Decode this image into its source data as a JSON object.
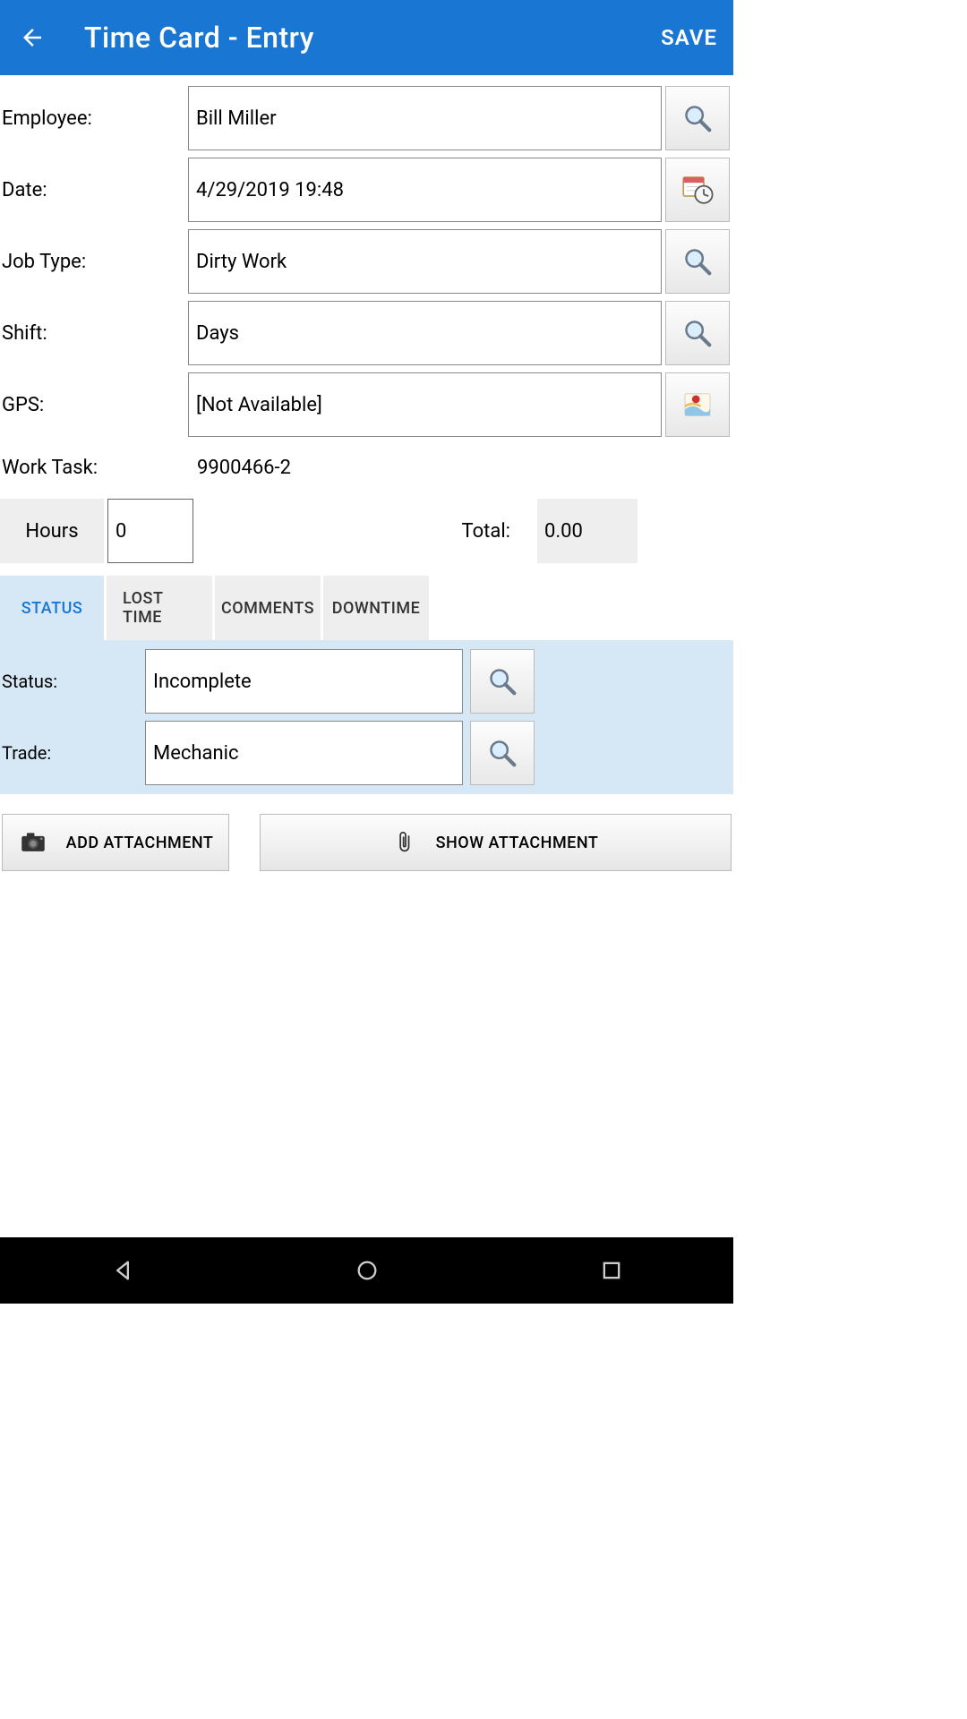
{
  "header": {
    "title": "Time Card - Entry",
    "save_label": "SAVE"
  },
  "fields": {
    "employee": {
      "label": "Employee:",
      "value": "Bill Miller"
    },
    "date": {
      "label": "Date:",
      "value": "4/29/2019 19:48"
    },
    "jobtype": {
      "label": "Job Type:",
      "value": "Dirty Work"
    },
    "shift": {
      "label": "Shift:",
      "value": "Days"
    },
    "gps": {
      "label": "GPS:",
      "value": "[Not Available]"
    },
    "worktask": {
      "label": "Work Task:",
      "value": "9900466-2"
    }
  },
  "hours": {
    "button_label": "Hours",
    "value": "0",
    "total_label": "Total:",
    "total_value": "0.00"
  },
  "tabs": {
    "items": [
      "STATUS",
      "LOST TIME",
      "COMMENTS",
      "DOWNTIME"
    ],
    "active_index": 0
  },
  "status_panel": {
    "status": {
      "label": "Status:",
      "value": "Incomplete"
    },
    "trade": {
      "label": "Trade:",
      "value": "Mechanic"
    }
  },
  "attachments": {
    "add_label": "ADD ATTACHMENT",
    "show_label": "SHOW ATTACHMENT"
  },
  "icons": {
    "back": "arrow-back-icon",
    "search": "magnifier-icon",
    "datetime": "calendar-clock-icon",
    "map": "map-icon",
    "camera": "camera-icon",
    "paperclip": "paperclip-icon"
  },
  "colors": {
    "accent": "#1976d2",
    "tab_active_bg": "#d6e8f5",
    "tab_inactive_bg": "#eeeeee"
  }
}
